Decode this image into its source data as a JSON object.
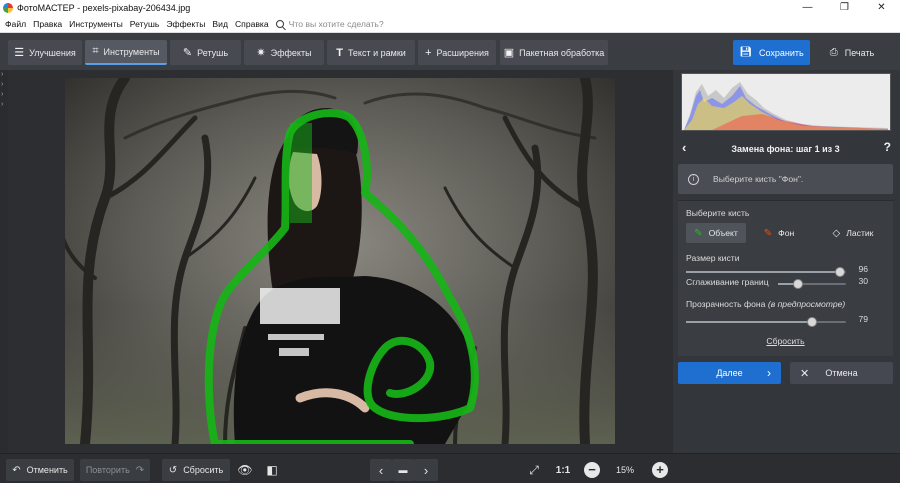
{
  "window": {
    "title": "ФотоМАСТЕР - pexels-pixabay-206434.jpg",
    "controls": [
      "—",
      "❐",
      "✕"
    ]
  },
  "menu": {
    "items": [
      "Файл",
      "Правка",
      "Инструменты",
      "Ретушь",
      "Эффекты",
      "Вид",
      "Справка"
    ],
    "search_placeholder": "Что вы хотите сделать?"
  },
  "toolbar": {
    "tabs": [
      {
        "label": "Улучшения",
        "icon": "sliders-icon"
      },
      {
        "label": "Инструменты",
        "icon": "crop-icon",
        "active": true
      },
      {
        "label": "Ретушь",
        "icon": "brush-icon"
      },
      {
        "label": "Эффекты",
        "icon": "sparkle-icon"
      },
      {
        "label": "Текст и рамки",
        "icon": "text-icon"
      },
      {
        "label": "Расширения",
        "icon": "plus-icon"
      },
      {
        "label": "Пакетная обработка",
        "icon": "batch-icon"
      }
    ],
    "save_label": "Сохранить",
    "print_label": "Печать"
  },
  "panel": {
    "step_title": "Замена фона: шаг 1 из 3",
    "help": "?",
    "hint": "Выберите кисть \"Фон\".",
    "select_brush_label": "Выберите кисть",
    "brushes": [
      {
        "label": "Объект",
        "icon": "object-brush-icon",
        "color": "#2fb52f",
        "active": true
      },
      {
        "label": "Фон",
        "icon": "background-brush-icon",
        "color": "#e8501e"
      },
      {
        "label": "Ластик",
        "icon": "eraser-icon"
      }
    ],
    "brush_size": {
      "label": "Размер кисти",
      "value": 96,
      "max": 100
    },
    "smoothing": {
      "label": "Сглаживание границ",
      "value": 30,
      "max": 100
    },
    "opacity": {
      "label": "Прозрачность фона",
      "label_note": "(в предпросмотре)",
      "value": 79,
      "max": 100
    },
    "reset_label": "Сбросить",
    "next_label": "Далее",
    "cancel_label": "Отмена"
  },
  "bottom": {
    "undo_label": "Отменить",
    "redo_label": "Повторить",
    "reset_label": "Сбросить",
    "ratio_label": "1:1",
    "zoom": "15%"
  },
  "colors": {
    "accent": "#1e6fd0",
    "selection_outline": "#17b417"
  }
}
